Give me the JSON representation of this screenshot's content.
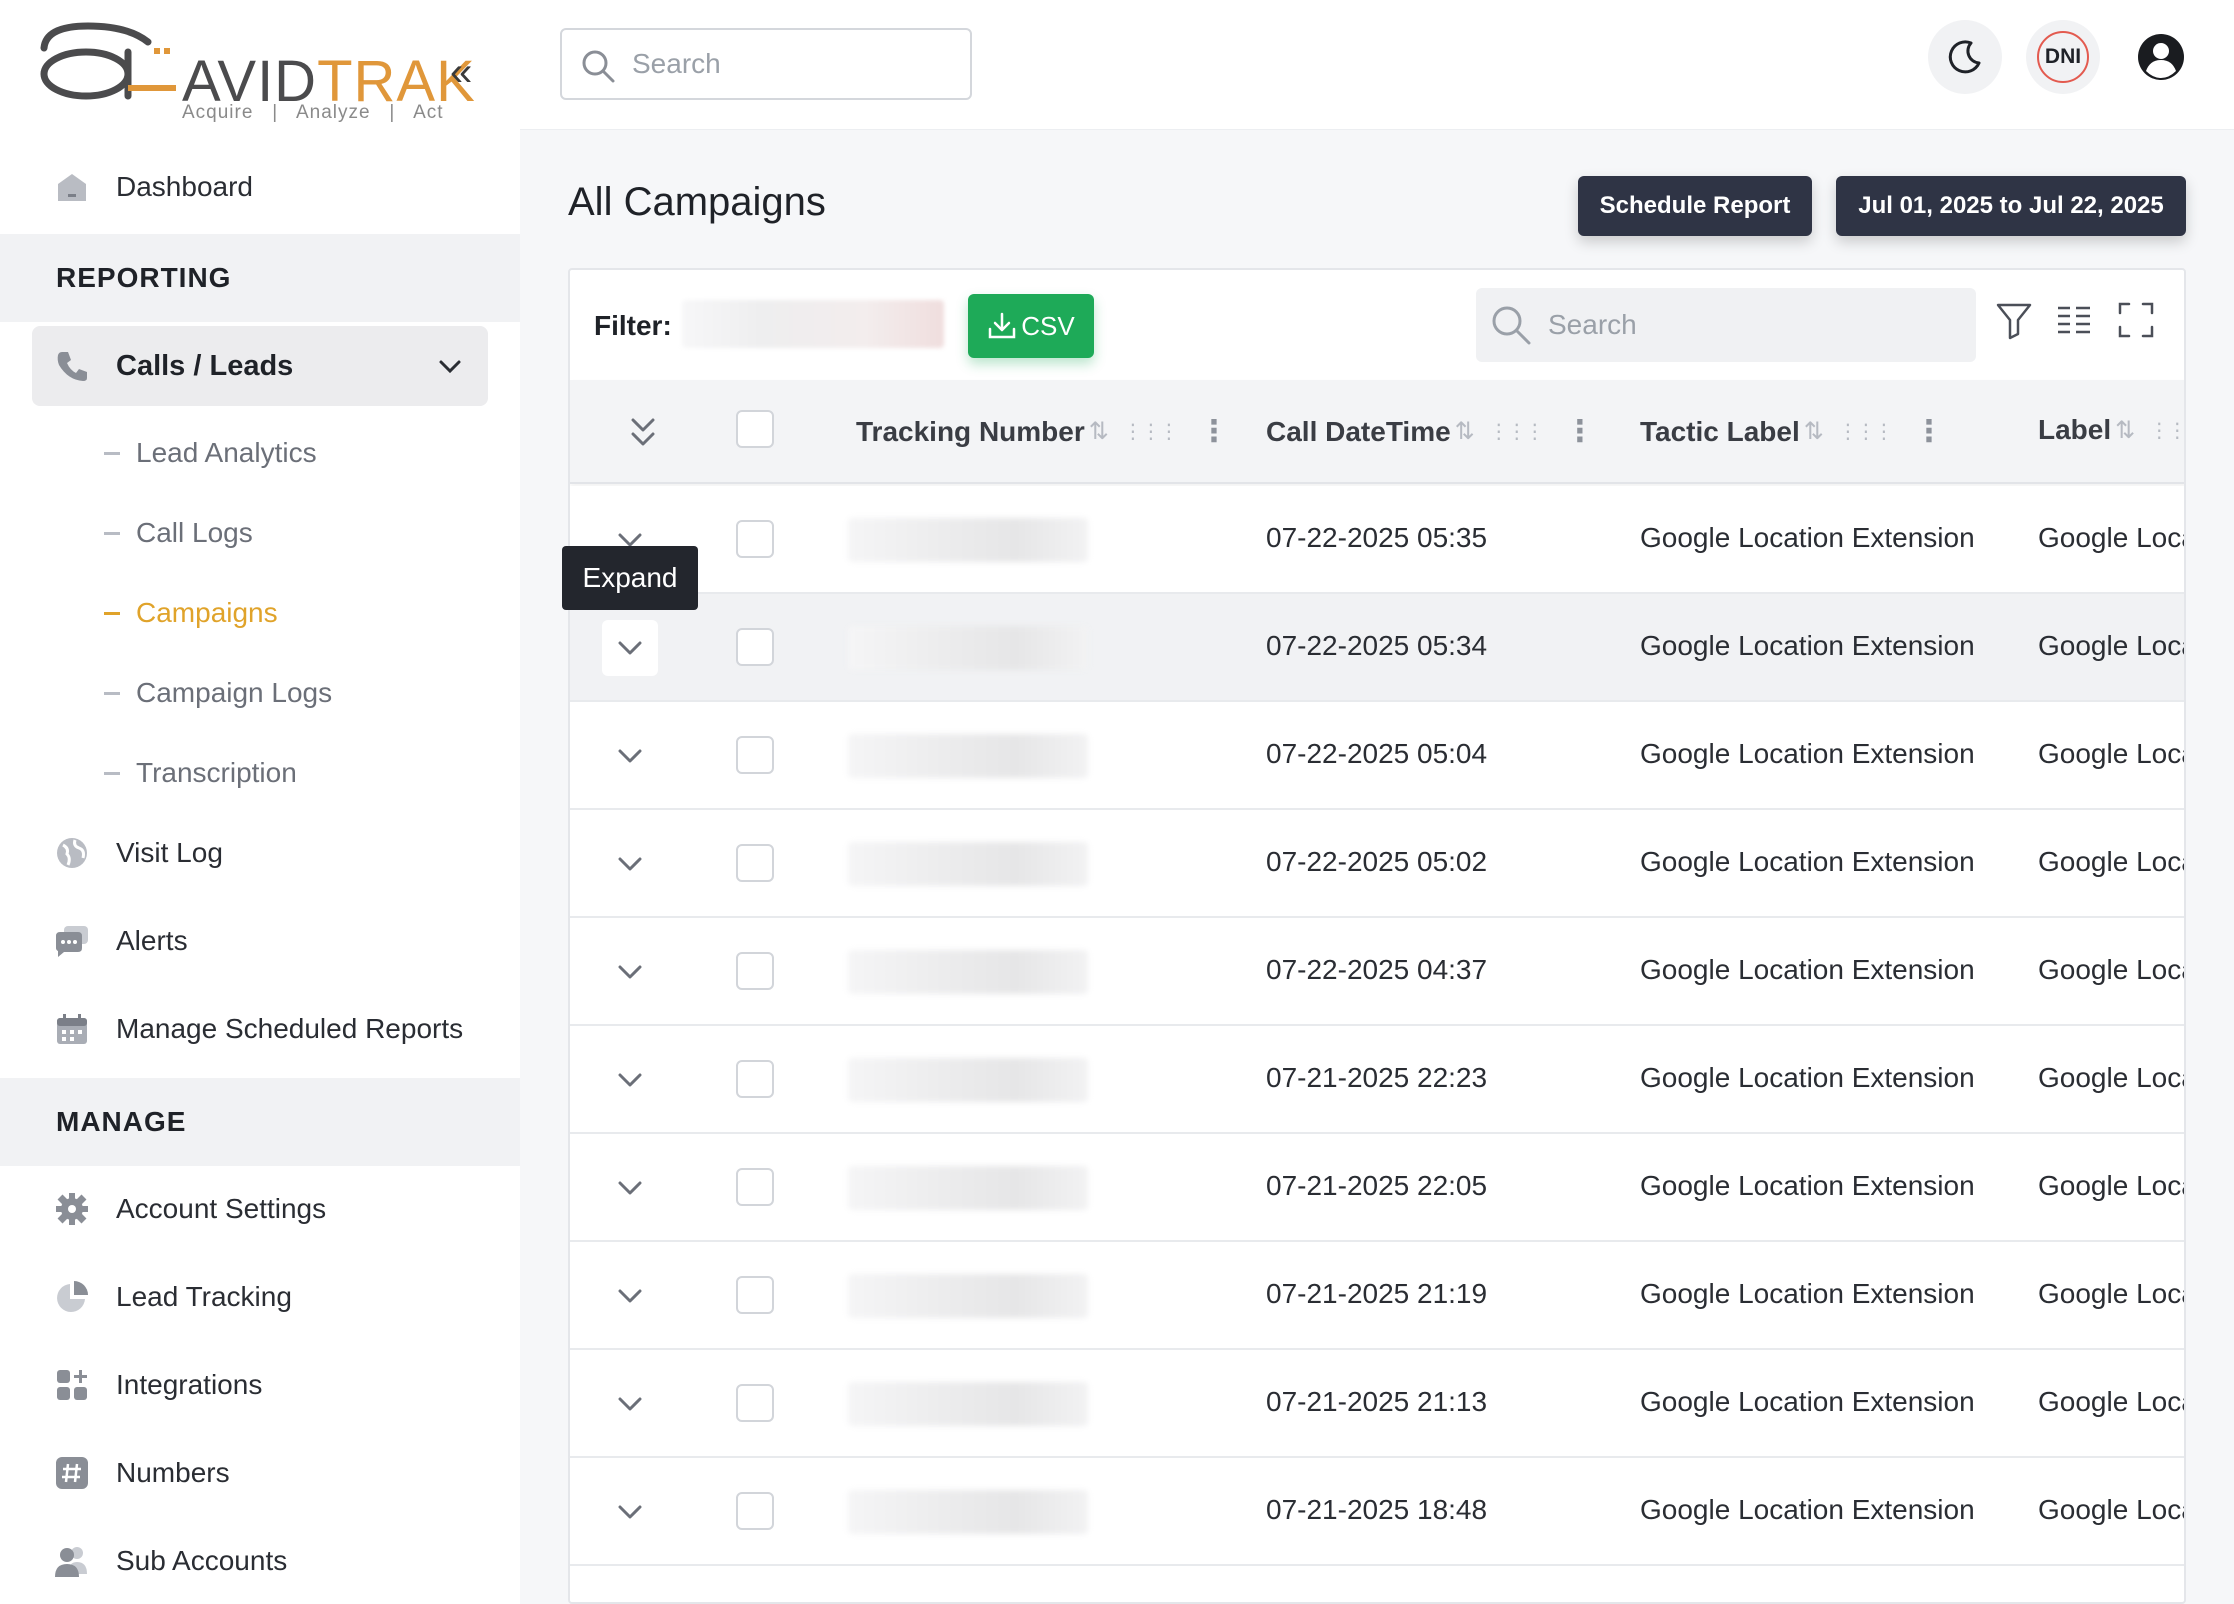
{
  "brand": {
    "name_left": "AVID",
    "name_right": "TRAK",
    "tagline": "Acquire   |   Analyze   |   Act"
  },
  "sidebar": {
    "dashboard": "Dashboard",
    "reporting_header": "REPORTING",
    "calls_leads": "Calls / Leads",
    "sub_items": [
      "Lead Analytics",
      "Call Logs",
      "Campaigns",
      "Campaign Logs",
      "Transcription"
    ],
    "active_sub_item": "Campaigns",
    "visit_log": "Visit Log",
    "alerts": "Alerts",
    "manage_scheduled_reports": "Manage Scheduled Reports",
    "manage_header": "MANAGE",
    "account_settings": "Account Settings",
    "lead_tracking": "Lead Tracking",
    "integrations": "Integrations",
    "numbers": "Numbers",
    "sub_accounts": "Sub Accounts"
  },
  "topbar": {
    "search_placeholder": "Search",
    "dni_label": "DNI"
  },
  "page": {
    "title": "All Campaigns",
    "schedule_report": "Schedule Report",
    "date_range": "Jul 01, 2025 to Jul 22, 2025"
  },
  "table": {
    "filter_label": "Filter:",
    "csv_label": "CSV",
    "search_placeholder": "Search",
    "columns": [
      "Tracking Number",
      "Call DateTime",
      "Tactic Label",
      "Label"
    ],
    "tooltip": "Expand",
    "rows": [
      {
        "call_datetime": "07-22-2025 05:35",
        "tactic_label": "Google Location Extension",
        "label": "Google Loca"
      },
      {
        "call_datetime": "07-22-2025 05:34",
        "tactic_label": "Google Location Extension",
        "label": "Google Loca"
      },
      {
        "call_datetime": "07-22-2025 05:04",
        "tactic_label": "Google Location Extension",
        "label": "Google Loca"
      },
      {
        "call_datetime": "07-22-2025 05:02",
        "tactic_label": "Google Location Extension",
        "label": "Google Loca"
      },
      {
        "call_datetime": "07-22-2025 04:37",
        "tactic_label": "Google Location Extension",
        "label": "Google Loca"
      },
      {
        "call_datetime": "07-21-2025 22:23",
        "tactic_label": "Google Location Extension",
        "label": "Google Loca"
      },
      {
        "call_datetime": "07-21-2025 22:05",
        "tactic_label": "Google Location Extension",
        "label": "Google Loca"
      },
      {
        "call_datetime": "07-21-2025 21:19",
        "tactic_label": "Google Location Extension",
        "label": "Google Loca"
      },
      {
        "call_datetime": "07-21-2025 21:13",
        "tactic_label": "Google Location Extension",
        "label": "Google Loca"
      },
      {
        "call_datetime": "07-21-2025 18:48",
        "tactic_label": "Google Location Extension",
        "label": "Google Loca"
      }
    ]
  },
  "colors": {
    "accent_orange": "#e0a32a",
    "csv_green": "#1eaa58",
    "dark_button": "#2f3445",
    "pagination_active": "#2b86d8"
  }
}
